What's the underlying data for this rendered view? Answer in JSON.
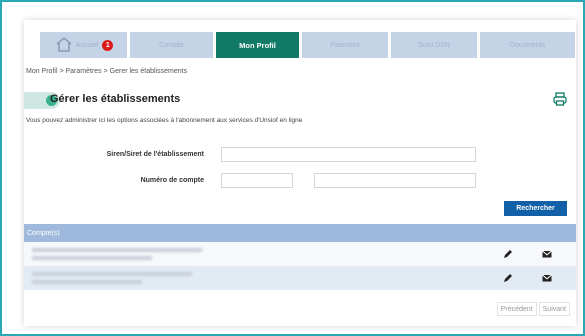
{
  "nav": {
    "tabs": [
      {
        "label": "Accueil",
        "badge": "1",
        "active": false
      },
      {
        "label": "Compte",
        "active": false
      },
      {
        "label": "Mon Profil",
        "active": true
      },
      {
        "label": "Paiement",
        "active": false
      },
      {
        "label": "Suivi DSN",
        "active": false
      },
      {
        "label": "Documents",
        "active": false
      }
    ]
  },
  "breadcrumb": "Mon Profil > Paramètres > Gerer les établissements",
  "page": {
    "title": "Gérer les établissements",
    "description": "Vous pouvez administrer ici les options associées à l'abonnement aux services d'Unsiof en ligne"
  },
  "form": {
    "siren_label": "Siren/Siret de l'établissement",
    "siren_value": "",
    "account_label": "Numéro de compte",
    "account_value": "",
    "account_key_value": "",
    "search_label": "Rechercher"
  },
  "table": {
    "header": "Compte(s)",
    "rows": 2
  },
  "pagination": {
    "prev": "Précédent",
    "next": "Suivant"
  },
  "colors": {
    "accent_green": "#107a66",
    "tab_inactive": "#c5d3e6",
    "primary_blue": "#1160a8",
    "table_header": "#9eb9dc",
    "badge_red": "#d91b1b",
    "frame": "#2aa8b5"
  },
  "icons": {
    "home": "home-icon",
    "print": "print-icon",
    "edit": "pencil-icon",
    "mail": "envelope-icon"
  }
}
